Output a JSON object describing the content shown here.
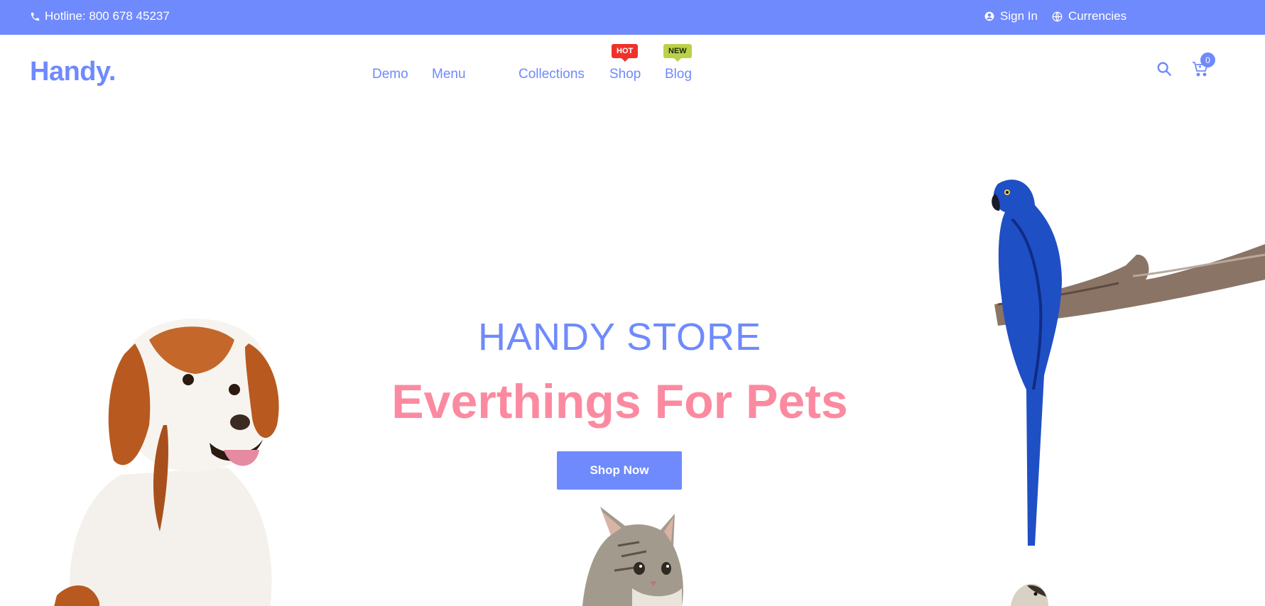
{
  "topbar": {
    "hotline": "Hotline: 800 678 45237",
    "sign_in": "Sign In",
    "currencies": "Currencies",
    "icons": [
      "phone-icon",
      "user-icon",
      "globe-icon"
    ]
  },
  "header": {
    "logo": "Handy.",
    "nav": [
      {
        "label": "Demo"
      },
      {
        "label": "Menu"
      },
      {
        "label": "Collections"
      },
      {
        "label": "Shop",
        "badge": "HOT"
      },
      {
        "label": "Blog",
        "badge": "NEW"
      }
    ],
    "cart_count": "0",
    "icons": [
      "search-icon",
      "cart-icon"
    ]
  },
  "hero": {
    "title": "HANDY STORE",
    "subtitle": "Everthings For Pets",
    "button": "Shop Now",
    "images": [
      "dog-image",
      "cat-image",
      "parrot-image",
      "hamster-image"
    ]
  },
  "colors": {
    "primary": "#6f8afc",
    "accent_pink": "#fb8aa0",
    "badge_hot": "#f0312b",
    "badge_new": "#b9d24a"
  }
}
